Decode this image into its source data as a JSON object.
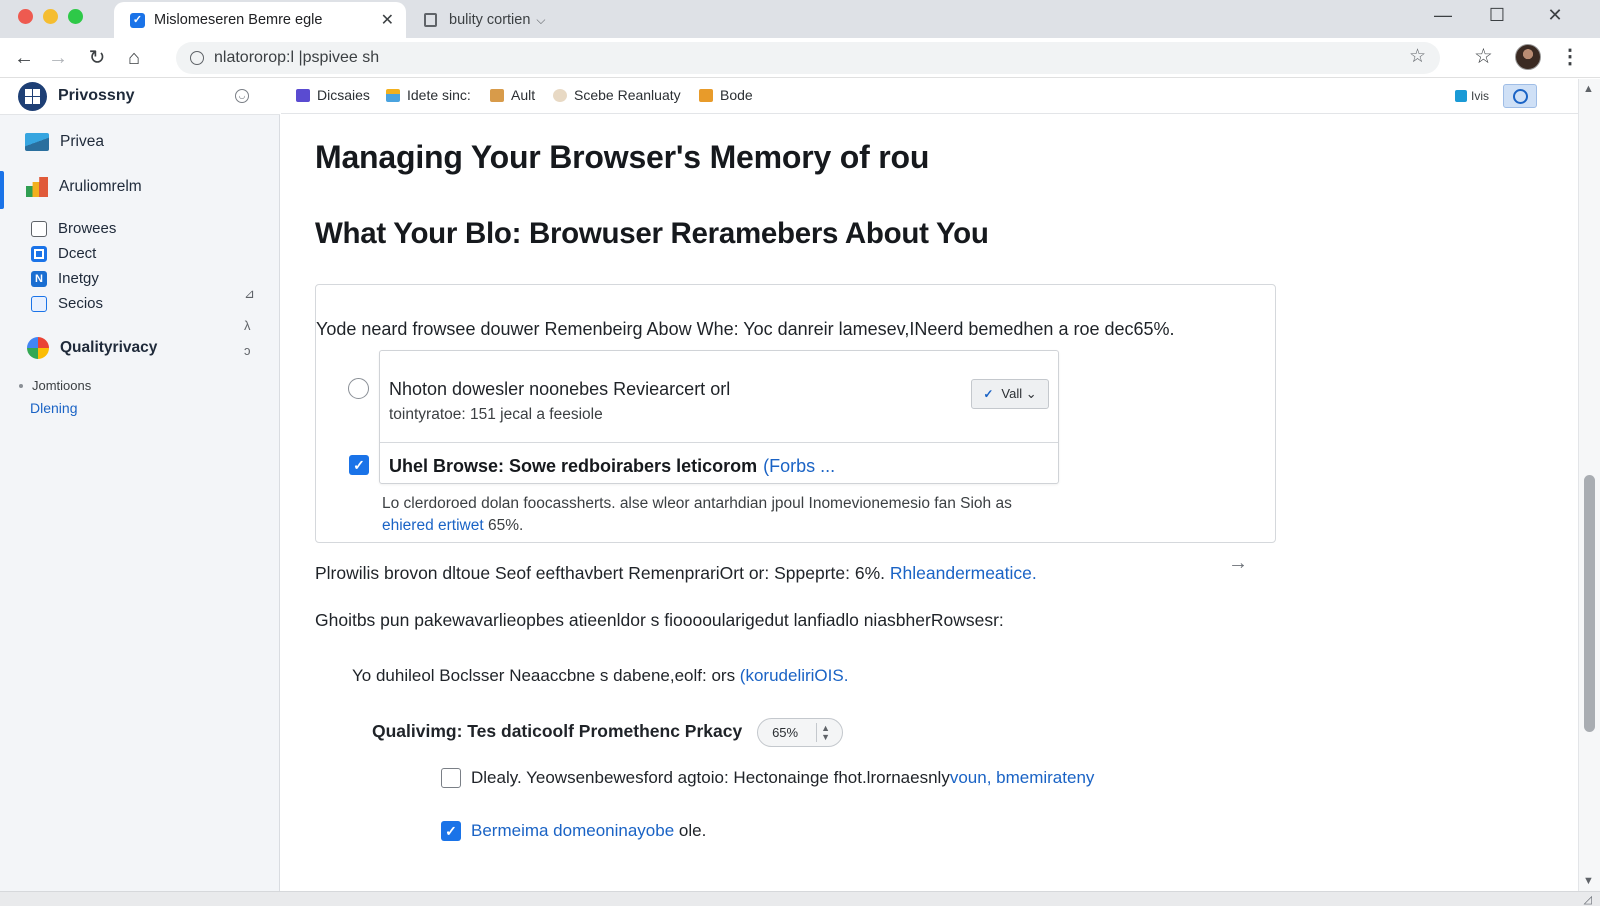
{
  "browser": {
    "tabs": [
      {
        "title": "Mislomeseren Bemre egle",
        "close": "✕"
      },
      {
        "title": "bulity cortien",
        "caret": "⌵"
      }
    ],
    "window_controls": {
      "minimize": "—",
      "maximize": "☐",
      "close": "✕"
    },
    "nav": {
      "back": "←",
      "forward": "→",
      "reload": "↻",
      "home": "⌂"
    },
    "address": "nlatororop:l |pspivee sh",
    "star": "☆",
    "menu": "⋮"
  },
  "sidebar": {
    "title": "Privossny",
    "header_button": "◡",
    "items": [
      {
        "label": "Privea",
        "icon": "laptop-icon"
      },
      {
        "label": "Aruliomrelm",
        "icon": "chart-icon",
        "selected": true
      },
      {
        "label": "Browees",
        "icon": "folder-icon"
      },
      {
        "label": "Dcect",
        "icon": "square-icon"
      },
      {
        "label": "Inetgy",
        "icon": "n-icon"
      },
      {
        "label": "Secios",
        "icon": "security-icon"
      },
      {
        "label": "Qualityrivacy",
        "icon": "quality-icon"
      }
    ],
    "side_glyphs": [
      "⊿",
      "λ",
      "ↄ"
    ],
    "sub": {
      "label": "Jomtioons",
      "link": "Dlening"
    }
  },
  "bookmarks": [
    {
      "label": "Dicsaies",
      "color": "#5a4bd1"
    },
    {
      "label": "Idete sinc:",
      "color": "#f2b01e"
    },
    {
      "label": "Ault",
      "color": "#d89b4a"
    },
    {
      "label": "Scebe Reanluaty",
      "color": "#e8d9c4"
    },
    {
      "label": "Bode",
      "color": "#e89b2a"
    }
  ],
  "extensions": {
    "ext1_label": "Ivis"
  },
  "main": {
    "h1": "Managing Your Browser's Memory of rou",
    "h2": "What Your Blo: Browuser Reramebers About You",
    "card": {
      "intro": "Yode neard frowsee douwer Remenbeirg  Abow Whe: Yoc danreir lamesev,INeerd bemedhen a roe dec65%.",
      "option1_title": "Nhoton dowesler noonebes Reviearcert orl",
      "option1_sub": "tointyratoe: 151 jecal a feesiole",
      "vall_label": "Vall ⌄",
      "option2_title": "Uhel Browse: Sowe redboirabers leticorom",
      "option2_link": "(Forbs     ...",
      "foot1": "Lo clerdoroed dolan foocassherts. alse wleor antarhdian jpoul Inomevionemesio fan Sioh as",
      "foot2_link": "ehiered ertiwet",
      "foot2_rest": " 65%."
    },
    "para1_text": "Plrowilis brovon dltoue Seof eefthavbert  RemenprariOrt or: Sppeprte: 6%. ",
    "para1_link": "Rhleandermeatice.",
    "para2": "Ghoitbs pun pakewavarlieopbes atieenldor s fiooooularigedut lanfiadlo niasbherRowsesr:",
    "para3_text": "Yo duhileol Boclsser Neaaccbne s dabene,eolf: ors ",
    "para3_link": "(korudeliriOIS.",
    "quality_label": "Qualivimg: Tes daticoolf Promethenc Prkacy",
    "quality_value": "65%",
    "check1_text": "Dlealy. Yeowsenbewesford agtoio: Hectonainge fhot.lrornaesnly",
    "check1_link": "voun, bmemirateny",
    "check2_link": "Bermeima domeoninayobe",
    "check2_rest": " ole."
  }
}
